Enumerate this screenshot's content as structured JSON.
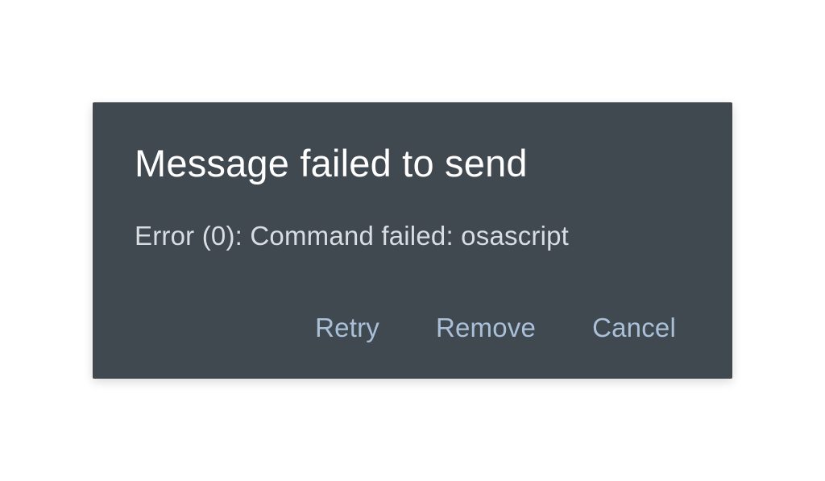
{
  "dialog": {
    "title": "Message failed to send",
    "message": "Error (0): Command failed: osascript",
    "buttons": {
      "retry": "Retry",
      "remove": "Remove",
      "cancel": "Cancel"
    }
  }
}
